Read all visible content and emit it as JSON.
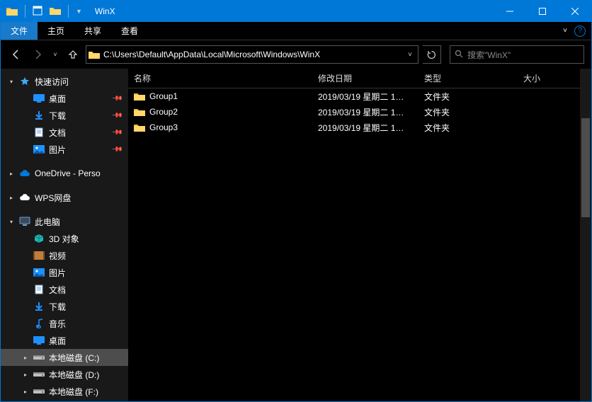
{
  "window": {
    "title": "WinX"
  },
  "ribbon": {
    "file": "文件",
    "tabs": [
      "主页",
      "共享",
      "查看"
    ]
  },
  "nav": {
    "path": "C:\\Users\\Default\\AppData\\Local\\Microsoft\\Windows\\WinX",
    "search_placeholder": "搜索\"WinX\""
  },
  "columns": {
    "name": "名称",
    "date": "修改日期",
    "type": "类型",
    "size": "大小"
  },
  "rows": [
    {
      "name": "Group1",
      "date": "2019/03/19 星期二 1…",
      "type": "文件夹",
      "size": ""
    },
    {
      "name": "Group2",
      "date": "2019/03/19 星期二 1…",
      "type": "文件夹",
      "size": ""
    },
    {
      "name": "Group3",
      "date": "2019/03/19 星期二 1…",
      "type": "文件夹",
      "size": ""
    }
  ],
  "sidebar": {
    "quick_access": "快速访问",
    "quick_items": [
      {
        "label": "桌面",
        "icon": "desktop",
        "pinned": true
      },
      {
        "label": "下载",
        "icon": "download",
        "pinned": true
      },
      {
        "label": "文档",
        "icon": "doc",
        "pinned": true
      },
      {
        "label": "图片",
        "icon": "picture",
        "pinned": true
      }
    ],
    "onedrive": "OneDrive - Perso",
    "wps": "WPS网盘",
    "this_pc": "此电脑",
    "pc_items": [
      {
        "label": "3D 对象",
        "icon": "cube"
      },
      {
        "label": "视频",
        "icon": "video"
      },
      {
        "label": "图片",
        "icon": "picture"
      },
      {
        "label": "文档",
        "icon": "doc"
      },
      {
        "label": "下载",
        "icon": "download"
      },
      {
        "label": "音乐",
        "icon": "music"
      },
      {
        "label": "桌面",
        "icon": "desktop"
      }
    ],
    "drives": [
      {
        "label": "本地磁盘 (C:)",
        "selected": true
      },
      {
        "label": "本地磁盘 (D:)",
        "selected": false
      },
      {
        "label": "本地磁盘 (F:)",
        "selected": false
      }
    ]
  }
}
